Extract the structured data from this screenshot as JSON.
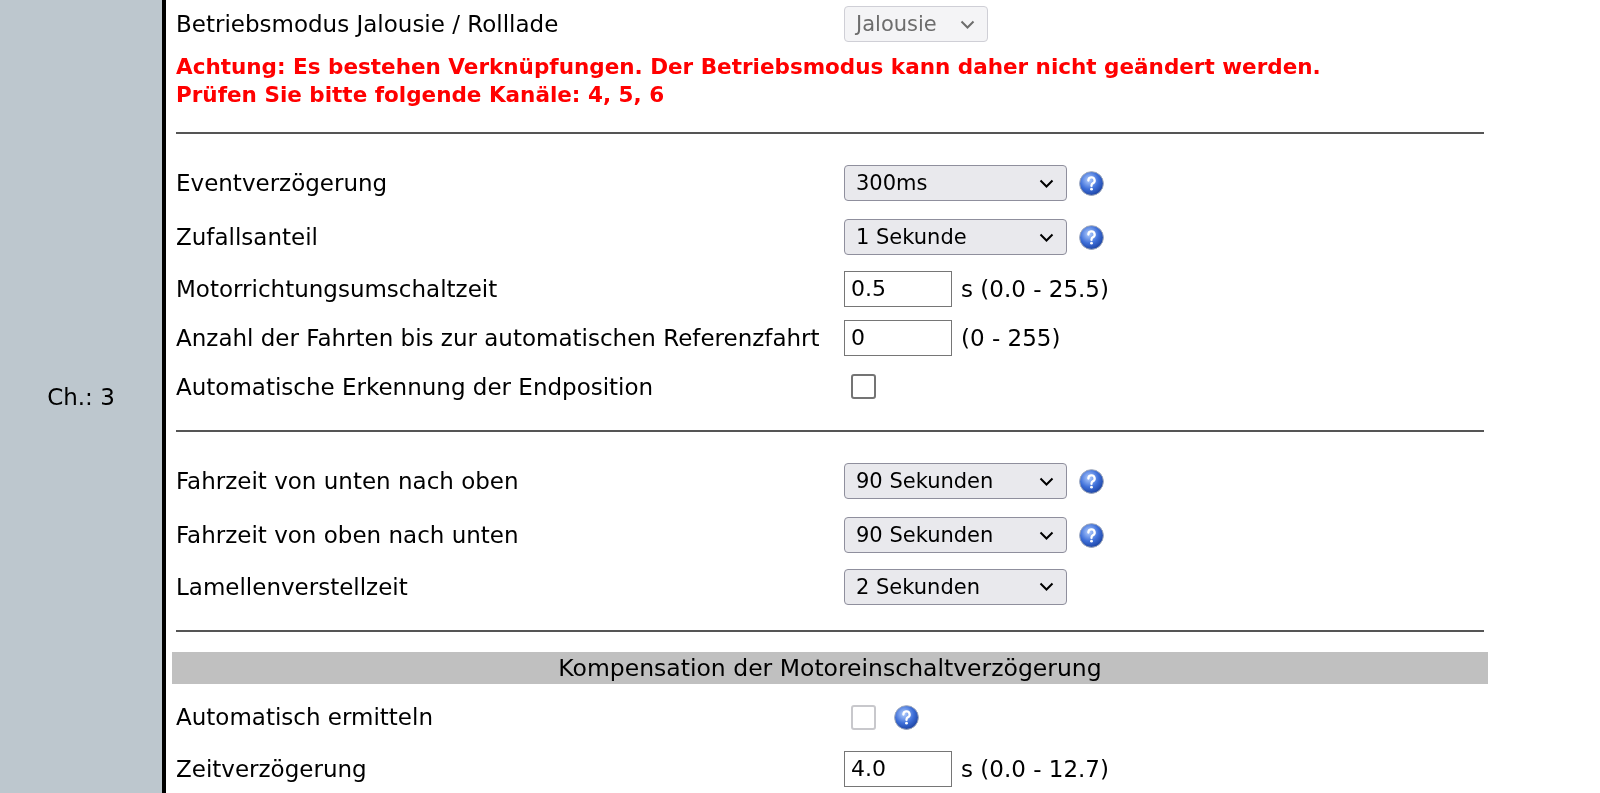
{
  "channel_label": "Ch.: 3",
  "mode": {
    "label": "Betriebsmodus Jalousie / Rolllade",
    "value": "Jalousie",
    "disabled": true
  },
  "warning_lines": [
    "Achtung: Es bestehen Verknüpfungen. Der Betriebsmodus kann daher nicht geändert werden.",
    "Prüfen Sie bitte folgende Kanäle: 4, 5, 6"
  ],
  "groups": [
    {
      "rows": [
        {
          "kind": "select",
          "label": "Eventverzögerung",
          "value": "300ms",
          "help": true
        },
        {
          "kind": "select",
          "label": "Zufallsanteil",
          "value": "1 Sekunde",
          "help": true
        },
        {
          "kind": "input",
          "label": "Motorrichtungsumschaltzeit",
          "value": "0.5",
          "hint": "s (0.0 - 25.5)",
          "help": false
        },
        {
          "kind": "input",
          "label": "Anzahl der Fahrten bis zur automatischen Referenzfahrt",
          "value": "0",
          "hint": "(0 - 255)",
          "help": false
        },
        {
          "kind": "checkbox",
          "label": "Automatische Erkennung der Endposition",
          "checked": false,
          "disabled": false,
          "help": false
        }
      ]
    },
    {
      "rows": [
        {
          "kind": "select",
          "label": "Fahrzeit von unten nach oben",
          "value": "90 Sekunden",
          "help": true
        },
        {
          "kind": "select",
          "label": "Fahrzeit von oben nach unten",
          "value": "90 Sekunden",
          "help": true
        },
        {
          "kind": "select",
          "label": "Lamellenverstellzeit",
          "value": "2 Sekunden",
          "help": false
        }
      ]
    }
  ],
  "section": {
    "title": "Kompensation der Motoreinschaltverzögerung",
    "rows": [
      {
        "kind": "checkbox",
        "label": "Automatisch ermitteln",
        "checked": false,
        "disabled": true,
        "help": true
      },
      {
        "kind": "input",
        "label": "Zeitverzögerung",
        "value": "4.0",
        "hint": "s (0.0 - 12.7)",
        "help": false
      }
    ]
  }
}
